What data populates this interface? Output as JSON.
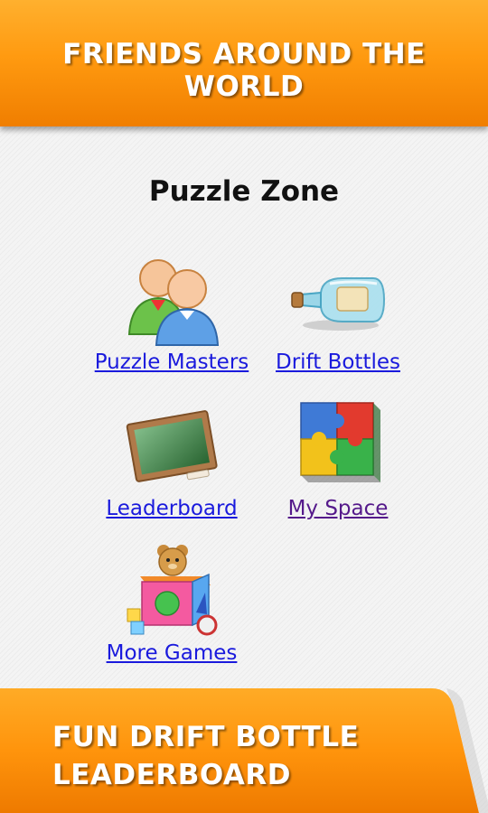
{
  "header": {
    "title": "FRIENDS AROUND THE WORLD"
  },
  "zone": {
    "title": "Puzzle Zone",
    "items": [
      {
        "label": "Puzzle Masters",
        "icon": "users-icon"
      },
      {
        "label": "Drift Bottles",
        "icon": "bottle-icon"
      },
      {
        "label": "Leaderboard",
        "icon": "chalkboard-icon"
      },
      {
        "label": "My Space",
        "icon": "puzzle-icon"
      },
      {
        "label": "More Games",
        "icon": "toybox-icon"
      }
    ]
  },
  "footer": {
    "line1": "FUN DRIFT BOTTLE",
    "line2": "LEADERBOARD"
  },
  "colors": {
    "banner_orange": "#ff9a10",
    "link_blue": "#1a1add",
    "link_visited": "#551a8b"
  }
}
